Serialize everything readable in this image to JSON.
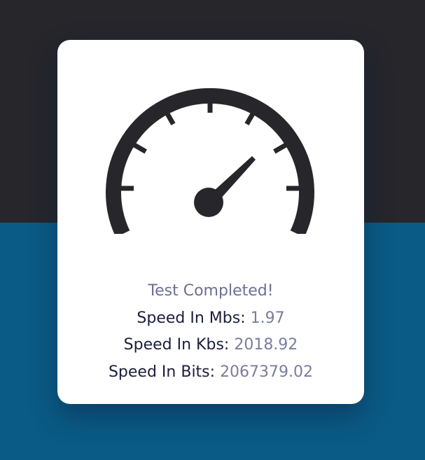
{
  "page": {
    "background_top_color": "#26262b",
    "background_bottom_color": "#0a5b86",
    "card_color": "#ffffff"
  },
  "gauge": {
    "icon": "speedometer-icon",
    "color": "#26262b",
    "needle_level": 0.72
  },
  "results": {
    "status": "Test Completed!",
    "mbs_label": "Speed In Mbs:",
    "mbs_value": "1.97",
    "kbs_label": "Speed In Kbs:",
    "kbs_value": "2018.92",
    "bits_label": "Speed In Bits:",
    "bits_value": "2067379.02"
  }
}
